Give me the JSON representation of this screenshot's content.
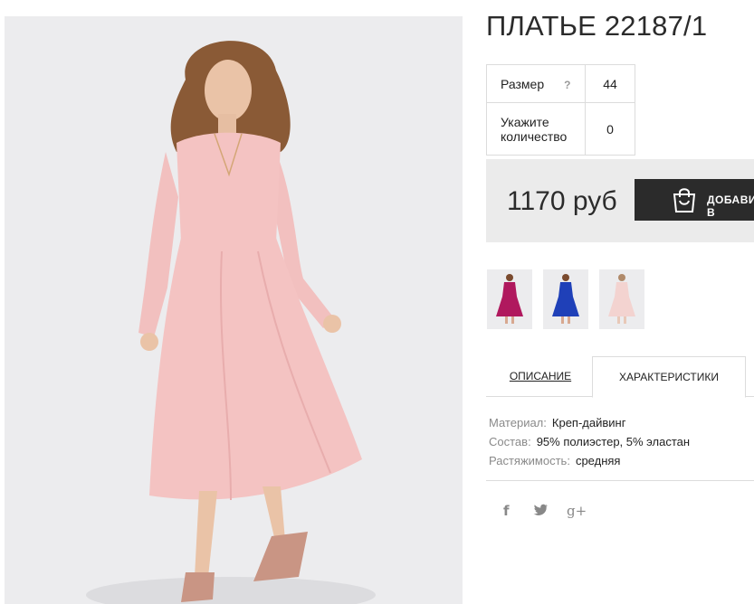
{
  "product": {
    "title": "ПЛАТЬЕ 22187/1",
    "photo_icon": "woman-in-pink-dress-photo"
  },
  "options": {
    "size_label": "Размер",
    "size_help": "?",
    "size_value": "44",
    "qty_label_line1": "Укажите",
    "qty_label_line2": "количество",
    "qty_value": "0"
  },
  "price": {
    "amount": "1170 руб",
    "cart_label": "ДОБАВИТЬ В КОРЗИНУ",
    "cart_icon": "shopping-bag-icon"
  },
  "variants": [
    {
      "name": "magenta",
      "color": "#b0195e"
    },
    {
      "name": "blue",
      "color": "#1f40b8"
    },
    {
      "name": "pink",
      "color": "#f3d3d0"
    }
  ],
  "tabs": {
    "description": "ОПИСАНИЕ",
    "characteristics": "ХАРАКТЕРИСТИКИ"
  },
  "characteristics": [
    {
      "key": "Материал:",
      "value": "Креп-дайвинг"
    },
    {
      "key": "Состав:",
      "value": "95% полиэстер, 5% эластан"
    },
    {
      "key": "Растяжимость:",
      "value": "средняя"
    }
  ],
  "social": {
    "facebook": "f",
    "twitter": "twitter-bird-icon",
    "google_plus": "g+"
  },
  "colors": {
    "button_bg": "#2b2b2b",
    "price_box_bg": "#ebebeb",
    "dress_pink": "#f4c3c2"
  }
}
